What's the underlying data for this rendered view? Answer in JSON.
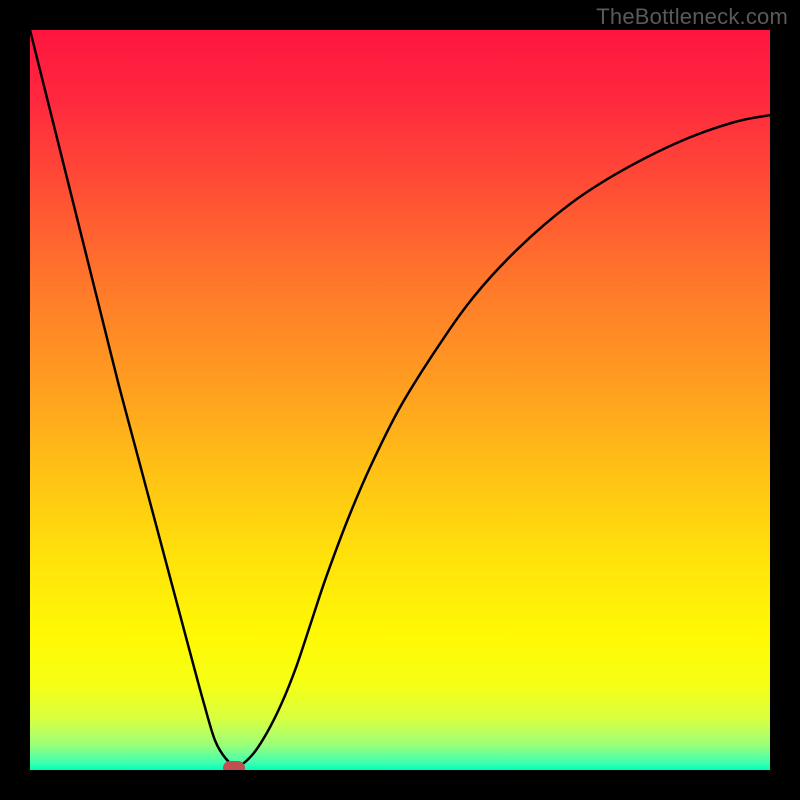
{
  "watermark": "TheBottleneck.com",
  "chart_data": {
    "type": "line",
    "title": "",
    "xlabel": "",
    "ylabel": "",
    "xlim": [
      0,
      100
    ],
    "ylim": [
      0,
      100
    ],
    "grid": false,
    "axes_visible": false,
    "background_gradient": {
      "direction": "vertical",
      "stops": [
        {
          "offset": 0.0,
          "color": "#ff153f"
        },
        {
          "offset": 0.1,
          "color": "#ff2a3e"
        },
        {
          "offset": 0.22,
          "color": "#ff5034"
        },
        {
          "offset": 0.35,
          "color": "#ff7a2a"
        },
        {
          "offset": 0.48,
          "color": "#ff9e20"
        },
        {
          "offset": 0.6,
          "color": "#ffc215"
        },
        {
          "offset": 0.72,
          "color": "#ffe40a"
        },
        {
          "offset": 0.82,
          "color": "#fff905"
        },
        {
          "offset": 0.885,
          "color": "#f6ff15"
        },
        {
          "offset": 0.93,
          "color": "#d8ff40"
        },
        {
          "offset": 0.965,
          "color": "#9dff78"
        },
        {
          "offset": 0.99,
          "color": "#40ffb0"
        },
        {
          "offset": 1.0,
          "color": "#00ffb8"
        }
      ]
    },
    "series": [
      {
        "name": "bottleneck-curve",
        "color": "#000000",
        "stroke_width": 2.5,
        "x": [
          0,
          2,
          4,
          6,
          8,
          10,
          12,
          14,
          16,
          18,
          20,
          22,
          23.5,
          25,
          26.5,
          28,
          30,
          32,
          34,
          36,
          38,
          40,
          43,
          46,
          50,
          55,
          60,
          66,
          73,
          80,
          88,
          95,
          100
        ],
        "values": [
          100,
          92,
          84,
          76,
          68,
          60,
          52,
          44.5,
          37,
          29.5,
          22,
          14.5,
          9,
          4,
          1.5,
          0.5,
          2,
          5,
          9,
          14,
          20,
          26,
          34,
          41,
          49,
          57,
          64,
          70.5,
          76.5,
          81,
          85,
          87.5,
          88.5
        ]
      }
    ],
    "min_marker": {
      "name": "minimum-point",
      "x": 27.5,
      "y": 0,
      "color": "#c05050"
    }
  }
}
